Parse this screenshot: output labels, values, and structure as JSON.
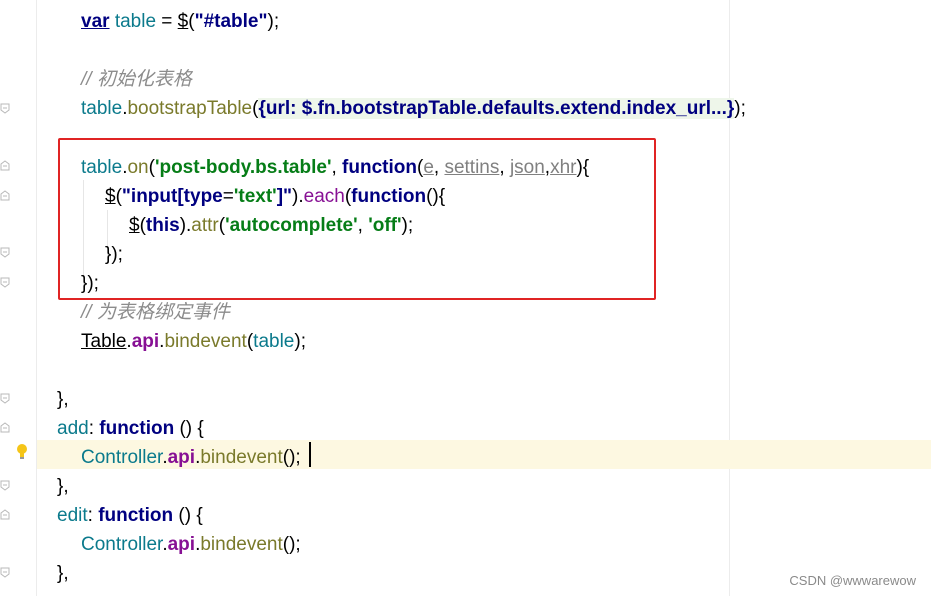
{
  "editor": {
    "lines": {
      "l1": {
        "kw": "var",
        "name": "table",
        "eq": " = ",
        "dollar": "$",
        "open": "(",
        "str": "\"#table\"",
        "close": ");"
      },
      "l3": {
        "comment": "// 初始化表格"
      },
      "l4": {
        "obj": "table",
        "dot": ".",
        "method": "bootstrapTable",
        "open": "(",
        "folded": "{url: $.fn.bootstrapTable.defaults.extend.index_url...}",
        "close": ");"
      },
      "l6": {
        "obj": "table",
        "dot": ".",
        "method": "on",
        "open": "(",
        "event": "'post-body.bs.table'",
        "comma": ", ",
        "kw": "function",
        "popen": "(",
        "p1": "e",
        "sep1": ", ",
        "p2": "settins",
        "sep2": ", ",
        "p3": "json",
        "sep3": ",",
        "p4": "xhr",
        "pclose": "){"
      },
      "l7": {
        "dollar": "$",
        "open": "(",
        "s1": "\"input[",
        "attr": "type",
        "eq": "=",
        "val": "'text'",
        "s2": "]\"",
        "close": ").",
        "method": "each",
        "popen": "(",
        "kw": "function",
        "pclose": "(){"
      },
      "l8": {
        "dollar": "$",
        "open": "(",
        "kw": "this",
        "close": ").",
        "method": "attr",
        "popen": "(",
        "a1": "'autocomplete'",
        "sep": ", ",
        "a2": "'off'",
        "pclose": ");"
      },
      "l9": {
        "text": "});"
      },
      "l10": {
        "text": "});"
      },
      "l11": {
        "comment": "// 为表格绑定事件"
      },
      "l12": {
        "obj": "Table",
        "dot": ".",
        "prop": "api",
        "dot2": ".",
        "method": "bindevent",
        "open": "(",
        "arg": "table",
        "close": ");"
      },
      "l14": {
        "text": "},"
      },
      "l15": {
        "name": "add",
        "colon": ": ",
        "kw": "function",
        "rest": " () {"
      },
      "l16": {
        "obj": "Controller",
        "dot": ".",
        "prop": "api",
        "dot2": ".",
        "method": "bindevent",
        "close": "();"
      },
      "l17": {
        "text": "},"
      },
      "l18": {
        "name": "edit",
        "colon": ": ",
        "kw": "function",
        "rest": " () {"
      },
      "l19": {
        "obj": "Controller",
        "dot": ".",
        "prop": "api",
        "dot2": ".",
        "method": "bindevent",
        "close": "();"
      },
      "l20": {
        "text": "},"
      }
    }
  },
  "watermark": "CSDN @wwwarewow",
  "colors": {
    "highlight_box": "#e02424",
    "caret_line": "#fdf8e1"
  }
}
